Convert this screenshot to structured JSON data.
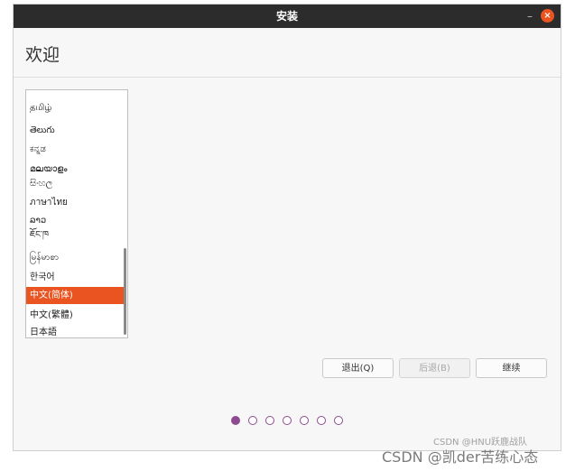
{
  "window": {
    "title": "安装",
    "minimize_label": "–",
    "close_label": "×"
  },
  "page": {
    "title": "欢迎"
  },
  "language_list": {
    "items": [
      {
        "label": "தமிழ்"
      },
      {
        "label": "తెలుగు"
      },
      {
        "label": "ಕನ್ನಡ"
      },
      {
        "label": "മലയാളം"
      },
      {
        "label": "සිංහල"
      },
      {
        "label": "ภาษาไทย"
      },
      {
        "label": "ລາວ"
      },
      {
        "label": "ཇོང་ཁ"
      },
      {
        "label": "မြန်မာစာ"
      },
      {
        "label": "한국어"
      },
      {
        "label": "中文(简体)",
        "selected": true
      },
      {
        "label": "中文(繁體)"
      },
      {
        "label": "日本語"
      }
    ]
  },
  "buttons": {
    "quit": "退出(Q)",
    "back": "后退(B)",
    "continue": "继续"
  },
  "progress": {
    "total_steps": 7,
    "current_step": 1
  },
  "watermark": {
    "small": "CSDN @HNU跃鹿战队",
    "large": "CSDN @凯der苦练心态"
  },
  "colors": {
    "accent": "#e95420",
    "purple": "#8e4a90",
    "titlebar": "#2c2c2c"
  }
}
